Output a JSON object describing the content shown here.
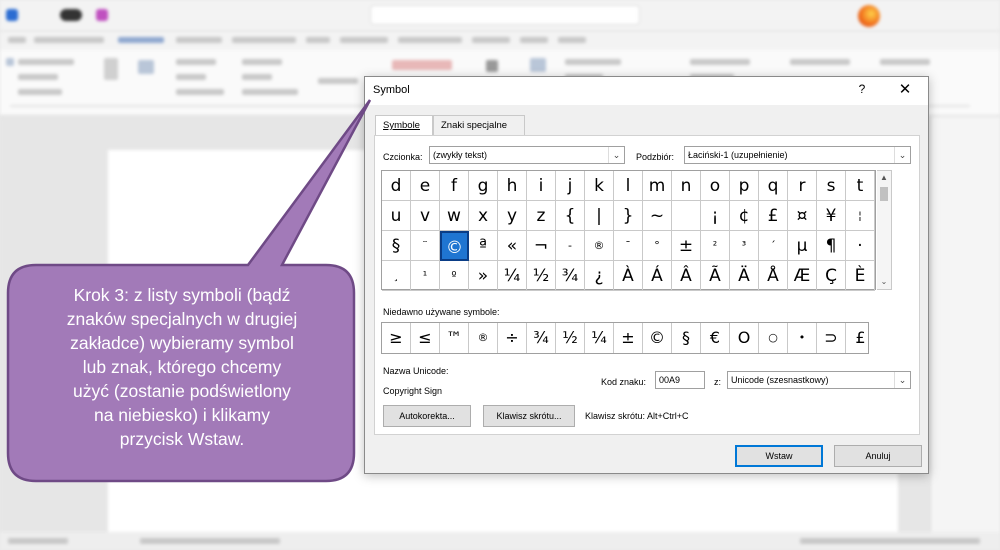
{
  "dialog": {
    "title": "Symbol",
    "help": "?",
    "close": "✕",
    "tabs": [
      {
        "label": "Symbole",
        "underline": "S"
      },
      {
        "label": "Znaki specjalne",
        "underline": "Z"
      }
    ],
    "font_label": "Czcionka:",
    "font_value": "(zwykły tekst)",
    "subset_label": "Podzbiór:",
    "subset_value": "Łaciński-1 (uzupełnienie)",
    "symbols": [
      [
        "d",
        "e",
        "f",
        "g",
        "h",
        "i",
        "j",
        "k",
        "l",
        "m",
        "n",
        "o",
        "p",
        "q",
        "r",
        "s",
        "t"
      ],
      [
        "u",
        "v",
        "w",
        "x",
        "y",
        "z",
        "{",
        "|",
        "}",
        "~",
        "",
        "¡",
        "¢",
        "£",
        "¤",
        "¥",
        "¦"
      ],
      [
        "§",
        "¨",
        "©",
        "ª",
        "«",
        "¬",
        "-",
        "®",
        "¯",
        "°",
        "±",
        "²",
        "³",
        "´",
        "µ",
        "¶",
        "·"
      ],
      [
        "¸",
        "¹",
        "º",
        "»",
        "¼",
        "½",
        "¾",
        "¿",
        "À",
        "Á",
        "Â",
        "Ã",
        "Ä",
        "Å",
        "Æ",
        "Ç",
        "È"
      ]
    ],
    "selected_symbol": "©",
    "recent_label": "Niedawno używane symbole:",
    "recent_symbols": [
      "≥",
      "≤",
      "™",
      "®",
      "÷",
      "¾",
      "½",
      "¼",
      "±",
      "©",
      "§",
      "€",
      "O",
      "○",
      "•",
      "⊃",
      "£"
    ],
    "unicode_name_label": "Nazwa Unicode:",
    "unicode_name_value": "Copyright Sign",
    "char_code_label": "Kod znaku:",
    "char_code_value": "00A9",
    "from_label": "z:",
    "from_value": "Unicode (szesnastkowy)",
    "autocorrect_button": "Autokorekta...",
    "shortcut_button": "Klawisz skrótu...",
    "shortcut_text": "Klawisz skrótu: Alt+Ctrl+C",
    "insert_button": "Wstaw",
    "cancel_button": "Anuluj"
  },
  "callout": {
    "lines": [
      "Krok 3: z listy symboli (bądź",
      "znaków specjalnych w drugiej",
      "zakładce) wybieramy symbol",
      "lub znak, którego chcemy",
      "użyć (zostanie podświetlony",
      "na niebiesko) i klikamy",
      "przycisk Wstaw."
    ],
    "fill": "#a27ab8",
    "stroke": "#6f4a86"
  }
}
